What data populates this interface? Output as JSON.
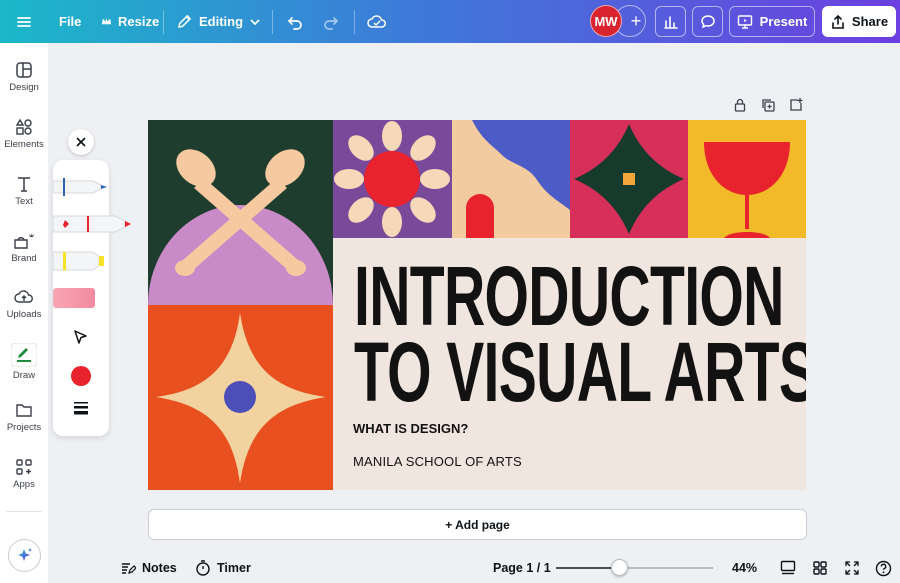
{
  "topbar": {
    "menu_icon": "hamburger-icon",
    "file": "File",
    "resize": "Resize",
    "editing": "Editing",
    "avatar_initials": "MW",
    "present": "Present",
    "share": "Share"
  },
  "sidebar": {
    "items": [
      {
        "label": "Design",
        "icon": "layout-icon"
      },
      {
        "label": "Elements",
        "icon": "shapes-icon"
      },
      {
        "label": "Text",
        "icon": "text-icon"
      },
      {
        "label": "Brand",
        "icon": "brand-icon"
      },
      {
        "label": "Uploads",
        "icon": "cloud-upload-icon"
      },
      {
        "label": "Draw",
        "icon": "draw-icon"
      },
      {
        "label": "Projects",
        "icon": "folder-icon"
      },
      {
        "label": "Apps",
        "icon": "apps-icon"
      }
    ],
    "active": "Draw"
  },
  "draw_panel": {
    "tools": [
      "pen-blue",
      "marker-red",
      "highlighter-yellow",
      "eraser-pink",
      "select-arrow"
    ],
    "color": "#e8232d",
    "stroke_icon": "stroke-weight-icon"
  },
  "slide": {
    "title_line1": "INTRODUCTION",
    "title_line2": "TO VISUAL ARTS",
    "subtitle": "WHAT IS DESIGN?",
    "school": "MANILA SCHOOL OF ARTS"
  },
  "canvas": {
    "add_page": "+ Add page"
  },
  "bottombar": {
    "notes": "Notes",
    "timer": "Timer",
    "page_indicator": "Page 1 / 1",
    "zoom": "44%",
    "zoom_fraction": 0.4
  },
  "colors": {
    "accent_gradient_start": "#1bb8c9",
    "accent_gradient_end": "#6c3fe0",
    "avatar": "#d9232e"
  }
}
